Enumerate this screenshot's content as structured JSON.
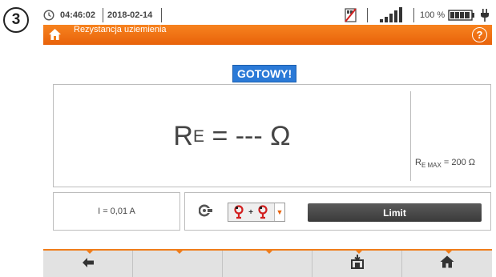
{
  "step_marker": "3",
  "status_bar": {
    "clock_icon": "clock-icon",
    "time": "04:46:02",
    "date": "2018-02-14",
    "no_sd_icon": "no-memory-card-icon",
    "signal_icon": "signal-strength-icon",
    "battery_percent": "100 %",
    "battery_icon": "battery-full-icon",
    "power_icon": "plug-icon"
  },
  "title_bar": {
    "home_icon": "home-icon",
    "title": "Rezystancja uziemienia",
    "help_icon": "help-icon",
    "help_glyph": "?",
    "accent": "#f07d1a"
  },
  "status_badge": {
    "text": "GOTOWY!",
    "color": "#2b7ad7"
  },
  "result": {
    "symbol": "R",
    "subscript": "E",
    "value": "= --- Ω",
    "limit_symbol": "R",
    "limit_subscript": "E MAX",
    "limit_value": "= 200 Ω"
  },
  "current": {
    "text": "I = 0,01 A"
  },
  "config": {
    "clamp_icon": "clamp-meter-icon",
    "method_value_icon": "two-clamps-method-icon",
    "method_plus": "+",
    "dropdown_icon": "triangle-down-icon",
    "limit_label": "Limit"
  },
  "toolbar": {
    "buttons": [
      {
        "icon": "back-arrow-icon"
      },
      {
        "icon": ""
      },
      {
        "icon": ""
      },
      {
        "icon": "save-memory-icon"
      },
      {
        "icon": "home-icon"
      }
    ]
  }
}
